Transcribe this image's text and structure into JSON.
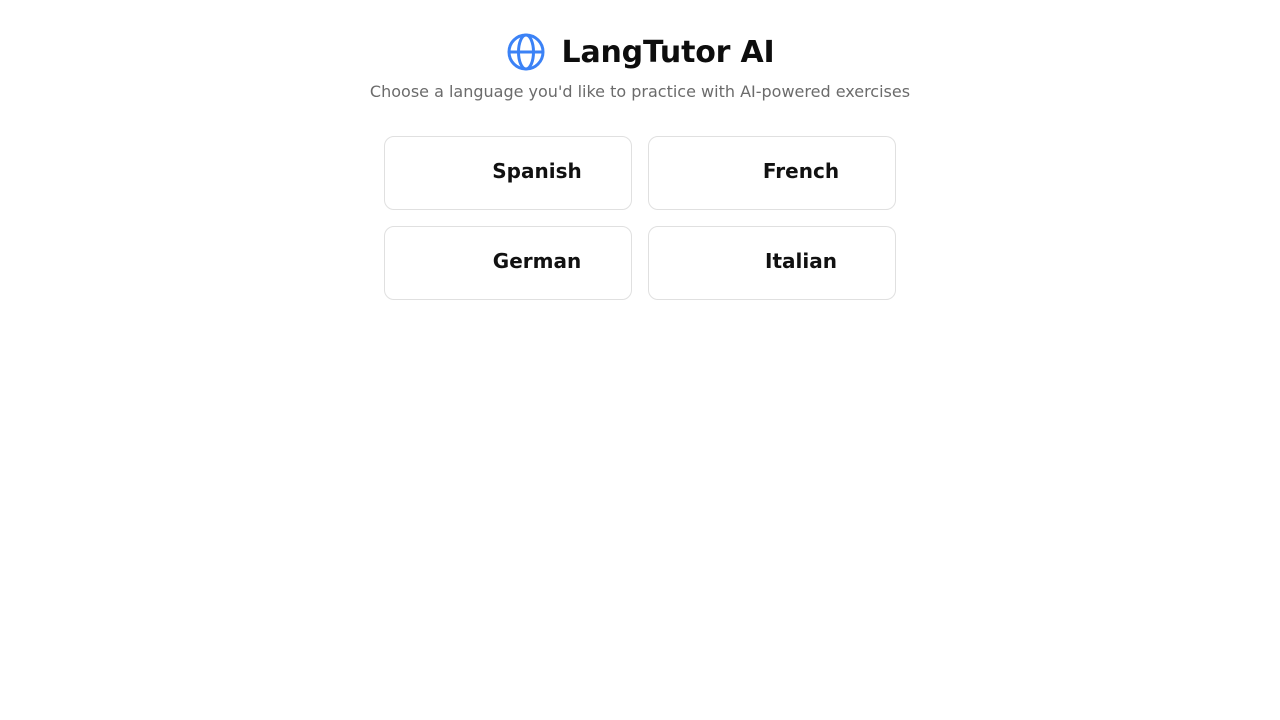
{
  "app": {
    "title": "LangTutor AI",
    "subtitle": "Choose a language you'd like to practice with AI-powered exercises",
    "logo_icon": "globe-icon",
    "accent_color": "#3b82f6"
  },
  "languages": [
    {
      "label": "Spanish"
    },
    {
      "label": "French"
    },
    {
      "label": "German"
    },
    {
      "label": "Italian"
    }
  ]
}
